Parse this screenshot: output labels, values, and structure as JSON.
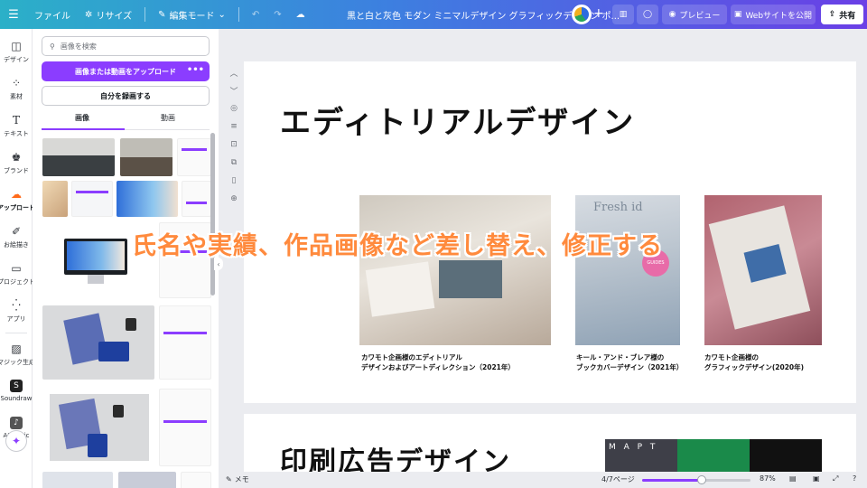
{
  "topbar": {
    "menu_icon": "hamburger-icon",
    "file_label": "ファイル",
    "resize_label": "リサイズ",
    "edit_mode_label": "編集モード",
    "doc_title": "黒と白と灰色 モダン ミニマルデザイン グラフィックデザイン ポ...",
    "preview_label": "プレビュー",
    "publish_label": "Webサイトを公開",
    "share_label": "共有"
  },
  "rail": {
    "items": [
      {
        "label": "デザイン",
        "icon": "layout-icon"
      },
      {
        "label": "素材",
        "icon": "shapes-icon"
      },
      {
        "label": "テキスト",
        "icon": "text-icon"
      },
      {
        "label": "ブランド",
        "icon": "brand-icon"
      },
      {
        "label": "アップロード",
        "icon": "upload-cloud-icon"
      },
      {
        "label": "お絵描き",
        "icon": "draw-icon"
      },
      {
        "label": "プロジェクト",
        "icon": "folder-icon"
      },
      {
        "label": "アプリ",
        "icon": "apps-icon"
      },
      {
        "label": "マジック生成",
        "icon": "magic-media-icon"
      },
      {
        "label": "Soundraw",
        "icon": "soundraw-icon"
      },
      {
        "label": "AI Music",
        "icon": "ai-music-icon"
      }
    ],
    "active_index": 4
  },
  "panel": {
    "search_placeholder": "画像を検索",
    "upload_label": "画像または動画をアップロード",
    "upload_more": "•••",
    "record_label": "自分を録画する",
    "tabs": [
      "画像",
      "動画"
    ]
  },
  "canvas": {
    "page1_heading": "エディトリアルデザイン",
    "captions": [
      "カワモト企画様のエディトリアル\nデザインおよびアートディレクション（2021年）",
      "キール・アンド・ブレア様の\nブックカバーデザイン（2021年）",
      "カワモト企画様の\nグラフィックデザイン(2020年)"
    ],
    "book_cover_text": "Fresh id",
    "book_guide_text": "GUIDES",
    "page2_heading": "印刷広告デザイン",
    "map_text": "M A P T"
  },
  "overlay_text": "氏名や実績、作品画像など差し替え、修正する",
  "bottombar": {
    "notes_label": "メモ",
    "page_indicator": "4/7ページ",
    "zoom_label": "87%",
    "zoom_fraction": 0.55
  },
  "colors": {
    "accent": "#8b3dff",
    "overlay": "#ff8a3d"
  }
}
